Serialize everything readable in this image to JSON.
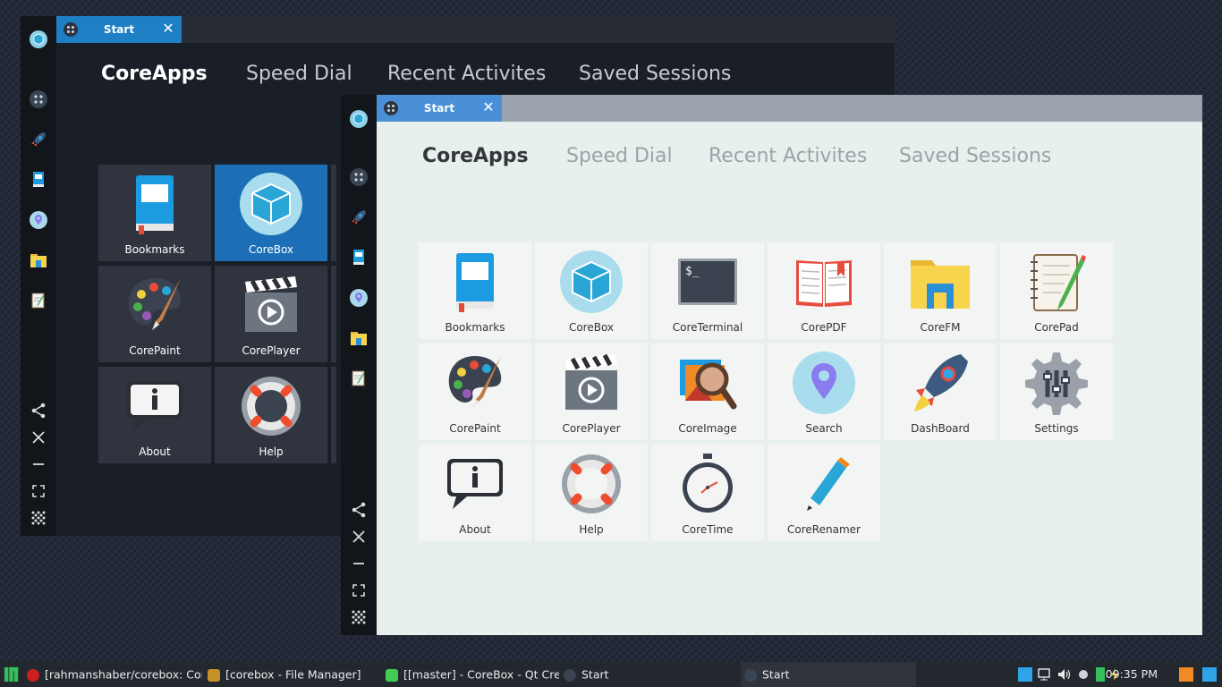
{
  "windows": [
    {
      "tab": {
        "label": "Start",
        "close": "✕"
      },
      "nav": [
        "CoreApps",
        "Speed Dial",
        "Recent Activites",
        "Saved Sessions"
      ],
      "apps": [
        "Bookmarks",
        "CoreBox",
        "CorePaint",
        "CorePlayer",
        "About",
        "Help"
      ]
    },
    {
      "tab": {
        "label": "Start",
        "close": "✕"
      },
      "nav": [
        "CoreApps",
        "Speed Dial",
        "Recent Activites",
        "Saved Sessions"
      ],
      "apps": [
        "Bookmarks",
        "CoreBox",
        "CoreTerminal",
        "CorePDF",
        "CoreFM",
        "CorePad",
        "CorePaint",
        "CorePlayer",
        "CoreImage",
        "Search",
        "DashBoard",
        "Settings",
        "About",
        "Help",
        "CoreTime",
        "CoreRenamer"
      ]
    }
  ],
  "sidebar_icons": [
    "corebox-icon",
    "dashboard-icon",
    "rocket-icon",
    "bookmarks-icon",
    "search-pin-icon",
    "folder-icon",
    "notepad-icon",
    "share-icon",
    "close-icon",
    "minimize-icon",
    "fullscreen-icon",
    "apps-grid-icon"
  ],
  "terminal_prompt": "$_",
  "taskbar": {
    "tasks": [
      "[rahmanshaber/corebox: Com...",
      "[corebox - File Manager]",
      "[[master] - CoreBox - Qt Cre...",
      "Start",
      "Start"
    ],
    "clock": "09:35 PM"
  },
  "colors": {
    "accent_blue": "#1f7fc4",
    "tab_blue_light": "#4a90d9",
    "dark_bg": "#1a1f27",
    "light_bg": "#e7f0ec"
  }
}
